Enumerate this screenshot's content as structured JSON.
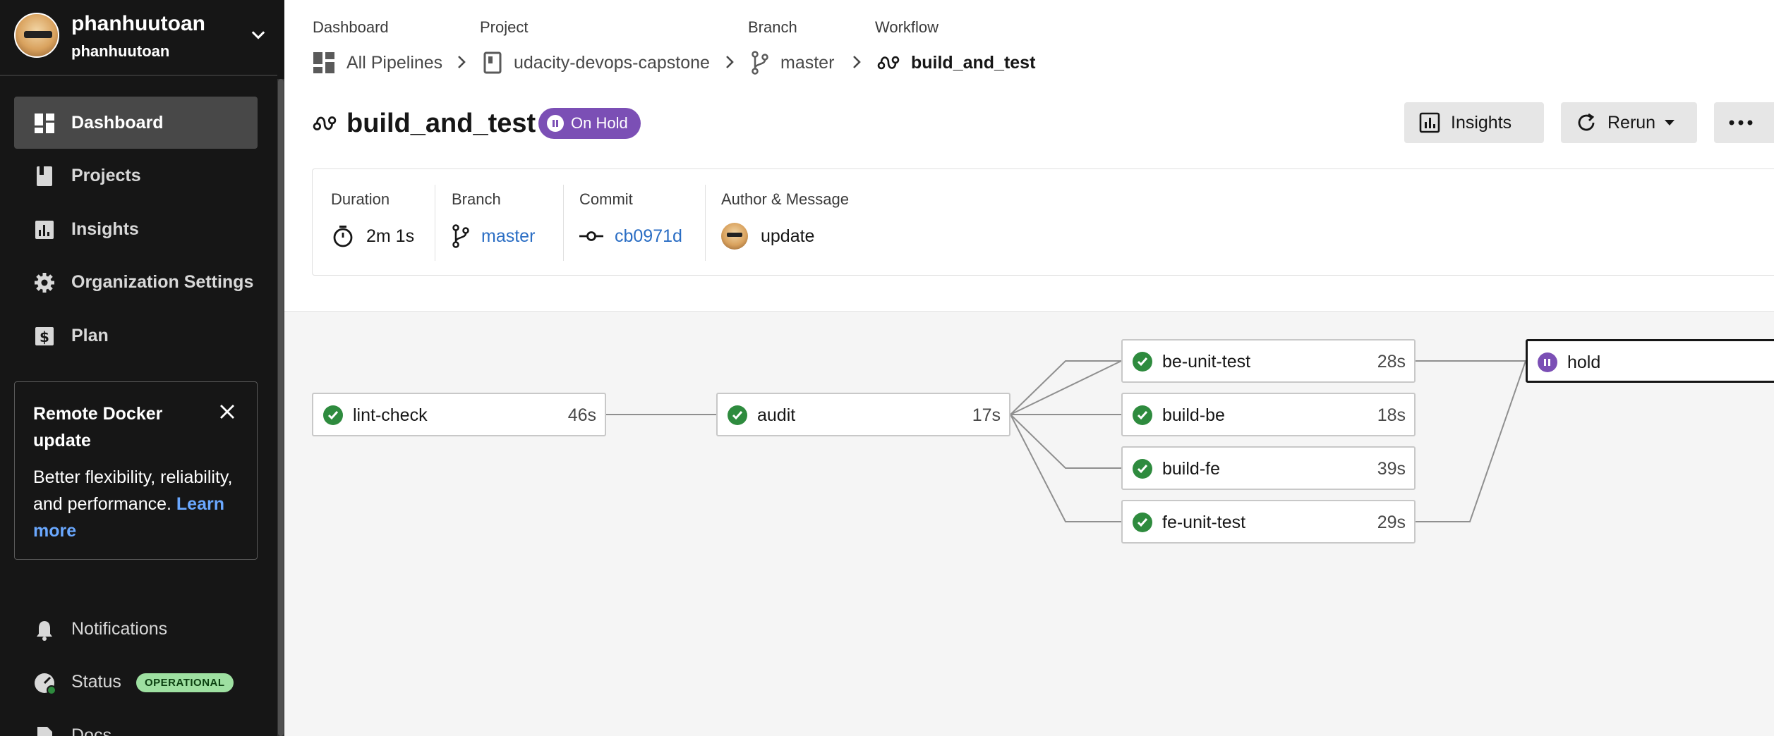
{
  "user": {
    "name": "phanhuutoan",
    "org": "phanhuutoan"
  },
  "nav": [
    {
      "label": "Dashboard",
      "icon": "dashboard-icon",
      "active": true
    },
    {
      "label": "Projects",
      "icon": "projects-icon",
      "active": false
    },
    {
      "label": "Insights",
      "icon": "insights-icon",
      "active": false
    },
    {
      "label": "Organization Settings",
      "icon": "gear-icon",
      "active": false
    },
    {
      "label": "Plan",
      "icon": "dollar-icon",
      "active": false
    }
  ],
  "promo": {
    "title": "Remote Docker update",
    "body": "Better flexibility, reliability, and performance.",
    "link": "Learn more"
  },
  "bottom_nav": {
    "notifications": "Notifications",
    "status": "Status",
    "status_badge": "OPERATIONAL",
    "docs": "Docs"
  },
  "breadcrumb": {
    "labels": [
      "Dashboard",
      "Project",
      "Branch",
      "Workflow"
    ],
    "items": [
      "All Pipelines",
      "udacity-devops-capstone",
      "master",
      "build_and_test"
    ]
  },
  "workflow": {
    "name": "build_and_test",
    "status": "On Hold"
  },
  "actions": {
    "insights": "Insights",
    "rerun": "Rerun"
  },
  "meta": {
    "duration_label": "Duration",
    "duration": "2m 1s",
    "branch_label": "Branch",
    "branch": "master",
    "commit_label": "Commit",
    "commit": "cb0971d",
    "author_label": "Author & Message",
    "message": "update"
  },
  "jobs": [
    {
      "name": "lint-check",
      "time": "46s",
      "status": "success"
    },
    {
      "name": "audit",
      "time": "17s",
      "status": "success"
    },
    {
      "name": "be-unit-test",
      "time": "28s",
      "status": "success"
    },
    {
      "name": "build-be",
      "time": "18s",
      "status": "success"
    },
    {
      "name": "build-fe",
      "time": "39s",
      "status": "success"
    },
    {
      "name": "fe-unit-test",
      "time": "29s",
      "status": "success"
    },
    {
      "name": "hold",
      "time": "",
      "status": "on-hold"
    }
  ],
  "colors": {
    "sidebar_bg": "#161616",
    "accent_purple": "#7b4fb5",
    "success": "#2e8b3e",
    "link": "#2b6ec4",
    "operational": "#9ee0a1"
  }
}
